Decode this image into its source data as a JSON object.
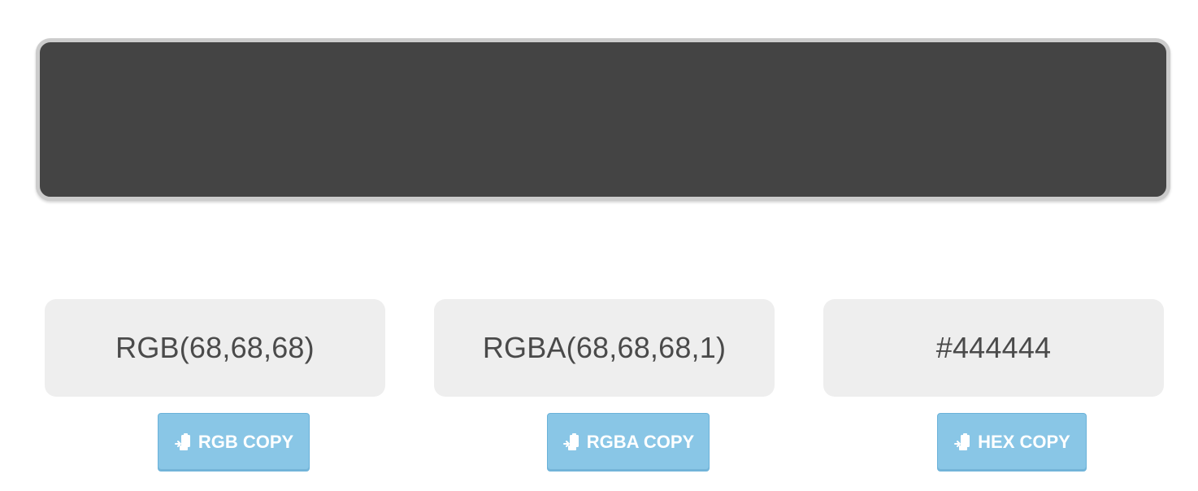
{
  "swatch": {
    "color": "#444444"
  },
  "values": {
    "rgb": "RGB(68,68,68)",
    "rgba": "RGBA(68,68,68,1)",
    "hex": "#444444"
  },
  "buttons": {
    "rgb_copy": "RGB COPY",
    "rgba_copy": "RGBA COPY",
    "hex_copy": "HEX COPY",
    "icon": "paste-clipboard-icon",
    "color": "#89c6e6"
  }
}
